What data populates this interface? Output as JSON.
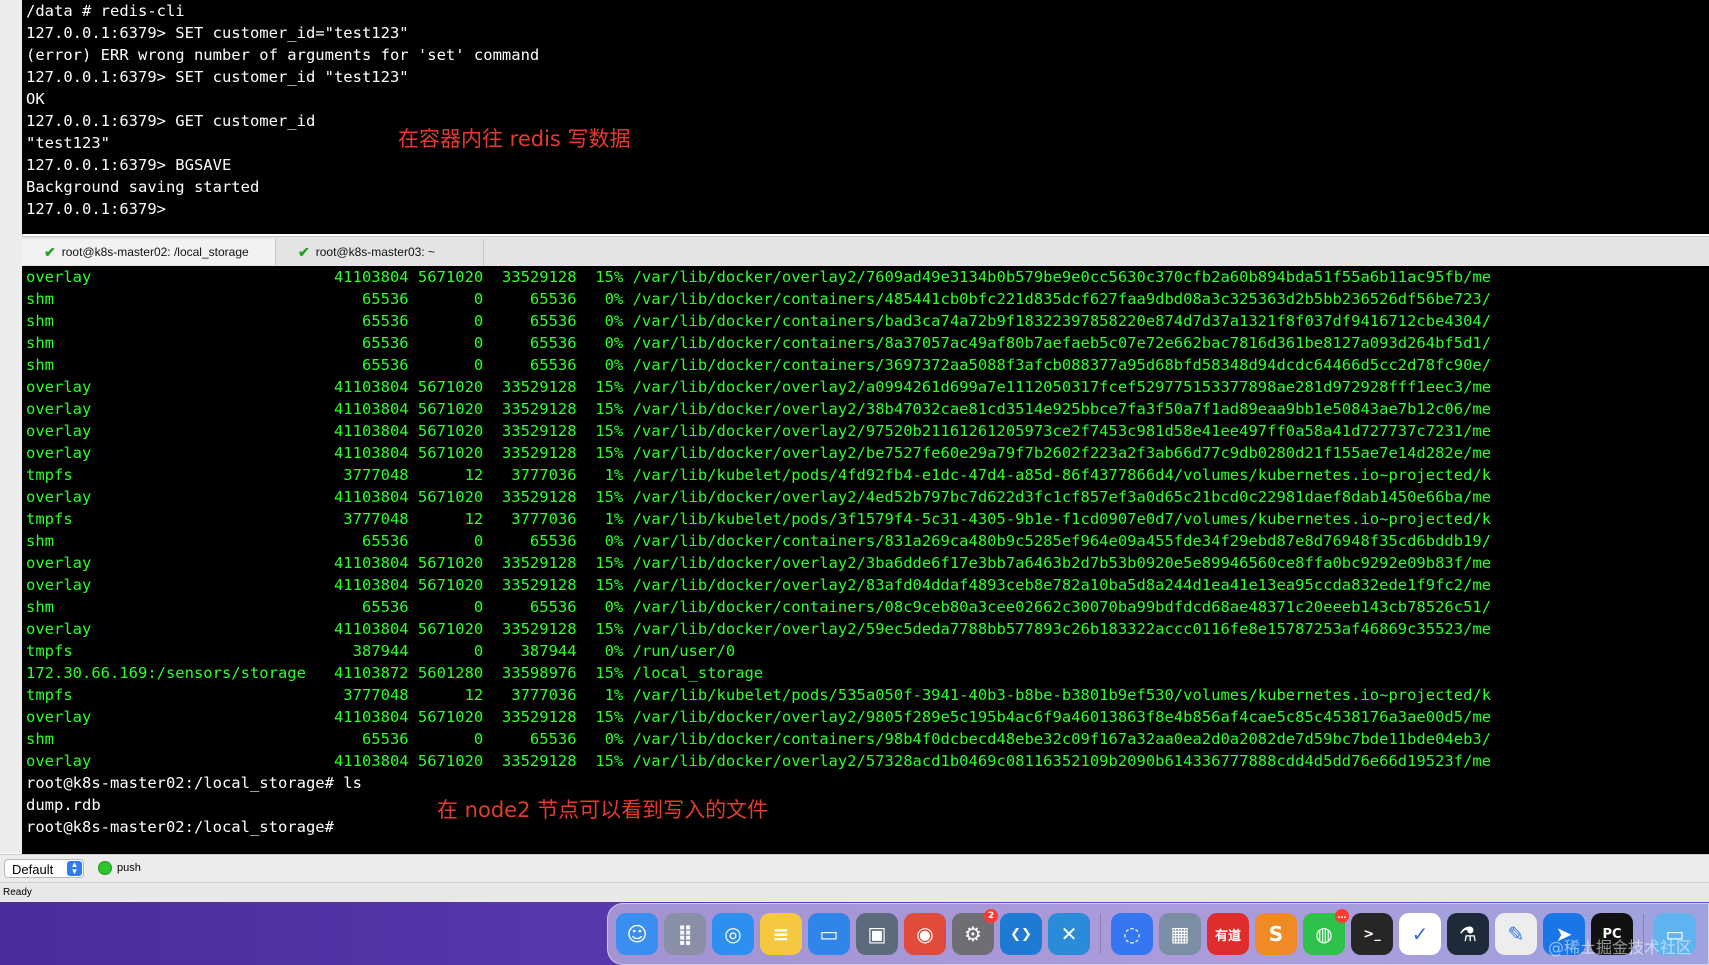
{
  "terminal_top": {
    "lines": [
      "/data # redis-cli",
      "127.0.0.1:6379> SET customer_id=\"test123\"",
      "(error) ERR wrong number of arguments for 'set' command",
      "127.0.0.1:6379> SET customer_id \"test123\"",
      "OK",
      "127.0.0.1:6379> GET customer_id",
      "\"test123\"",
      "127.0.0.1:6379> BGSAVE",
      "Background saving started",
      "127.0.0.1:6379>"
    ],
    "annotation": "在容器内往 redis 写数据"
  },
  "tabs": [
    {
      "label": "root@k8s-master02: /local_storage",
      "active": true
    },
    {
      "label": "root@k8s-master03: ~",
      "active": false
    }
  ],
  "terminal_bottom": {
    "lines": [
      "overlay                          41103804 5671020  33529128  15% /var/lib/docker/overlay2/7609ad49e3134b0b579be9e0cc5630c370cfb2a60b894bda51f55a6b11ac95fb/me",
      "shm                                 65536       0     65536   0% /var/lib/docker/containers/485441cb0bfc221d835dcf627faa9dbd08a3c325363d2b5bb236526df56be723/",
      "shm                                 65536       0     65536   0% /var/lib/docker/containers/bad3ca74a72b9f18322397858220e874d7d37a1321f8f037df9416712cbe4304/",
      "shm                                 65536       0     65536   0% /var/lib/docker/containers/8a37057ac49af80b7aefaeb5c07e72e662bac7816d361be8127a093d264bf5d1/",
      "shm                                 65536       0     65536   0% /var/lib/docker/containers/3697372aa5088f3afcb088377a95d68bfd58348d94dcdc64466d5cc2d78fc90e/",
      "overlay                          41103804 5671020  33529128  15% /var/lib/docker/overlay2/a0994261d699a7e1112050317fcef529775153377898ae281d972928fff1eec3/me",
      "overlay                          41103804 5671020  33529128  15% /var/lib/docker/overlay2/38b47032cae81cd3514e925bbce7fa3f50a7f1ad89eaa9bb1e50843ae7b12c06/me",
      "overlay                          41103804 5671020  33529128  15% /var/lib/docker/overlay2/97520b21161261205973ce2f7453c981d58e41ee497ff0a58a41d727737c7231/me",
      "overlay                          41103804 5671020  33529128  15% /var/lib/docker/overlay2/be7527fe60e29a79f7b2602f223a2f3ab66d77c9db0280d21f155ae7e14d282e/me",
      "tmpfs                             3777048      12   3777036   1% /var/lib/kubelet/pods/4fd92fb4-e1dc-47d4-a85d-86f4377866d4/volumes/kubernetes.io~projected/k",
      "overlay                          41103804 5671020  33529128  15% /var/lib/docker/overlay2/4ed52b797bc7d622d3fc1cf857ef3a0d65c21bcd0c22981daef8dab1450e66ba/me",
      "tmpfs                             3777048      12   3777036   1% /var/lib/kubelet/pods/3f1579f4-5c31-4305-9b1e-f1cd0907e0d7/volumes/kubernetes.io~projected/k",
      "shm                                 65536       0     65536   0% /var/lib/docker/containers/831a269ca480b9c5285ef964e09a455fde34f29ebd87e8d76948f35cd6bddb19/",
      "overlay                          41103804 5671020  33529128  15% /var/lib/docker/overlay2/3ba6dde6f17e3bb7a6463b2d7b53b0920e5e89946560ce8ffa0bc9292e09b83f/me",
      "overlay                          41103804 5671020  33529128  15% /var/lib/docker/overlay2/83afd04ddaf4893ceb8e782a10ba5d8a244d1ea41e13ea95ccda832ede1f9fc2/me",
      "shm                                 65536       0     65536   0% /var/lib/docker/containers/08c9ceb80a3cee02662c30070ba99bdfdcd68ae48371c20eeeb143cb78526c51/",
      "overlay                          41103804 5671020  33529128  15% /var/lib/docker/overlay2/59ec5deda7788bb577893c26b183322accc0116fe8e15787253af46869c35523/me",
      "tmpfs                              387944       0    387944   0% /run/user/0",
      "172.30.66.169:/sensors/storage   41103872 5601280  33598976  15% /local_storage",
      "tmpfs                             3777048      12   3777036   1% /var/lib/kubelet/pods/535a050f-3941-40b3-b8be-b3801b9ef530/volumes/kubernetes.io~projected/k",
      "overlay                          41103804 5671020  33529128  15% /var/lib/docker/overlay2/9805f289e5c195b4ac6f9a46013863f8e4b856af4cae5c85c4538176a3ae00d5/me",
      "shm                                 65536       0     65536   0% /var/lib/docker/containers/98b4f0dcbecd48ebe32c09f167a32aa0ea2d0a2082de7d59bc7bde11bde04eb3/",
      "overlay                          41103804 5671020  33529128  15% /var/lib/docker/overlay2/57328acd1b0469c08116352109b2090b614336777888cdd4d5dd76e66d19523f/me"
    ],
    "prompt_lines": [
      "root@k8s-master02:/local_storage# ls",
      "dump.rdb",
      "root@k8s-master02:/local_storage#"
    ],
    "annotation": "在 node2 节点可以看到写入的文件"
  },
  "statusbar": {
    "profile": "Default",
    "push_label": "push",
    "ready": "Ready"
  },
  "dock": {
    "apps": [
      {
        "name": "finder-icon",
        "glyph": "☺",
        "color": "#3a8ef0"
      },
      {
        "name": "launchpad-icon",
        "glyph": "⣿",
        "color": "#8a8fa8"
      },
      {
        "name": "safari-icon",
        "glyph": "◎",
        "color": "#2d8ff0"
      },
      {
        "name": "notes-icon",
        "glyph": "≡",
        "color": "#f5c842"
      },
      {
        "name": "keynote-icon",
        "glyph": "▭",
        "color": "#2f86e8"
      },
      {
        "name": "preview-icon",
        "glyph": "▣",
        "color": "#5b6b7b"
      },
      {
        "name": "chrome-icon",
        "glyph": "◉",
        "color": "#e04b3a"
      },
      {
        "name": "system-preferences-icon",
        "glyph": "⚙",
        "color": "#6e6e73",
        "badge": "2"
      },
      {
        "name": "vscode-icon",
        "glyph": "❮❯",
        "color": "#1f7ad4"
      },
      {
        "name": "vscode-insiders-icon",
        "glyph": "✕",
        "color": "#2a8cd9"
      },
      {
        "name": "sep",
        "glyph": ""
      },
      {
        "name": "feishu-icon",
        "glyph": "◌",
        "color": "#3577f0"
      },
      {
        "name": "finder-window-icon",
        "glyph": "▦",
        "color": "#7c8ea3"
      },
      {
        "name": "youdao-icon",
        "glyph": "有道",
        "color": "#e02c2c"
      },
      {
        "name": "sublime-icon",
        "glyph": "S",
        "color": "#ef8a27"
      },
      {
        "name": "wechat-icon",
        "glyph": "◍",
        "color": "#2ec24a",
        "badge": "…"
      },
      {
        "name": "terminal-icon",
        "glyph": ">_",
        "color": "#262626"
      },
      {
        "name": "tick-tick-icon",
        "glyph": "✓",
        "color": "#ffffff"
      },
      {
        "name": "lab-icon",
        "glyph": "⚗",
        "color": "#1c2a3a"
      },
      {
        "name": "textedit-icon",
        "glyph": "✎",
        "color": "#ededed"
      },
      {
        "name": "xcode-icon",
        "glyph": "➤",
        "color": "#1a76e8"
      },
      {
        "name": "pycharm-icon",
        "glyph": "PC",
        "color": "#111111"
      },
      {
        "name": "sep",
        "glyph": ""
      },
      {
        "name": "folder-icon",
        "glyph": "▭",
        "color": "#5fb4ef"
      }
    ]
  },
  "watermark": "@稀土掘金技术社区"
}
